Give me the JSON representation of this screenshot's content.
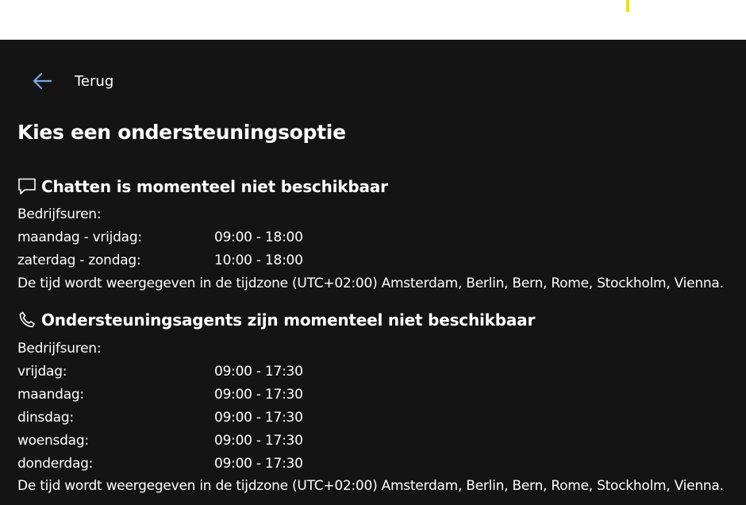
{
  "nav": {
    "back_label": "Terug"
  },
  "page": {
    "title": "Kies een ondersteuningsoptie"
  },
  "chat": {
    "title": "Chatten is momenteel niet beschikbaar",
    "hours_label": "Bedrijfsuren:",
    "rows": [
      {
        "day": "maandag - vrijdag:",
        "time": "09:00 - 18:00"
      },
      {
        "day": "zaterdag - zondag:",
        "time": "10:00 - 18:00"
      }
    ],
    "timezone_note": "De tijd wordt weergegeven in de tijdzone (UTC+02:00) Amsterdam, Berlin, Bern, Rome, Stockholm, Vienna."
  },
  "phone": {
    "title": "Ondersteuningsagents zijn momenteel niet beschikbaar",
    "hours_label": "Bedrijfsuren:",
    "rows": [
      {
        "day": "vrijdag:",
        "time": "09:00 - 17:30"
      },
      {
        "day": "maandag:",
        "time": "09:00 - 17:30"
      },
      {
        "day": "dinsdag:",
        "time": "09:00 - 17:30"
      },
      {
        "day": "woensdag:",
        "time": "09:00 - 17:30"
      },
      {
        "day": "donderdag:",
        "time": "09:00 - 17:30"
      }
    ],
    "timezone_note": "De tijd wordt weergegeven in de tijdzone (UTC+02:00) Amsterdam, Berlin, Bern, Rome, Stockholm, Vienna."
  },
  "icons": {
    "back": "arrow-left-icon",
    "chat": "chat-bubble-icon",
    "phone": "phone-icon"
  },
  "colors": {
    "panel_background": "#141414",
    "back_arrow": "#7aa7e6",
    "topbar_accent": "#f2e200"
  }
}
